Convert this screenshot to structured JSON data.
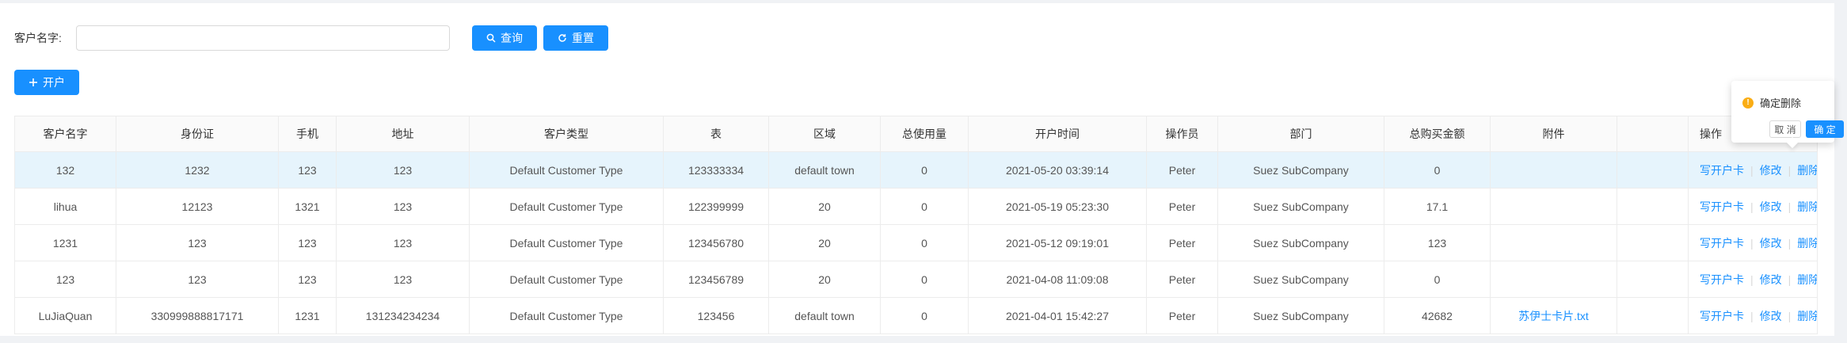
{
  "filter": {
    "label": "客户名字:",
    "input_value": "",
    "input_placeholder": "",
    "query_label": "查询",
    "reset_label": "重置"
  },
  "toolbar": {
    "add_label": "开户"
  },
  "table": {
    "headers": [
      "客户名字",
      "身份证",
      "手机",
      "地址",
      "客户类型",
      "表",
      "区域",
      "总使用量",
      "开户时间",
      "操作员",
      "部门",
      "总购买金额",
      "附件",
      "",
      "操作"
    ],
    "rows": [
      [
        "132",
        "1232",
        "123",
        "123",
        "Default Customer Type",
        "123333334",
        "default town",
        "0",
        "2021-05-20 03:39:14",
        "Peter",
        "Suez SubCompany",
        "0",
        ""
      ],
      [
        "lihua",
        "12123",
        "1321",
        "123",
        "Default Customer Type",
        "122399999",
        "20",
        "0",
        "2021-05-19 05:23:30",
        "Peter",
        "Suez SubCompany",
        "17.1",
        ""
      ],
      [
        "1231",
        "123",
        "123",
        "123",
        "Default Customer Type",
        "123456780",
        "20",
        "0",
        "2021-05-12 09:19:01",
        "Peter",
        "Suez SubCompany",
        "123",
        ""
      ],
      [
        "123",
        "123",
        "123",
        "123",
        "Default Customer Type",
        "123456789",
        "20",
        "0",
        "2021-04-08 11:09:08",
        "Peter",
        "Suez SubCompany",
        "0",
        ""
      ],
      [
        "LuJiaQuan",
        "330999888817171",
        "1231",
        "131234234234",
        "Default Customer Type",
        "123456",
        "default town",
        "0",
        "2021-04-01 15:42:27",
        "Peter",
        "Suez SubCompany",
        "42682",
        "苏伊士卡片.txt"
      ]
    ],
    "actions": {
      "write_card": "写开户卡",
      "edit": "修改",
      "delete": "删除"
    }
  },
  "popconfirm": {
    "title": "确定删除",
    "cancel_label": "取 消",
    "ok_label": "确 定"
  },
  "colors": {
    "primary": "#1890ff",
    "warning": "#faad14",
    "row_highlight": "#e6f4fc"
  }
}
